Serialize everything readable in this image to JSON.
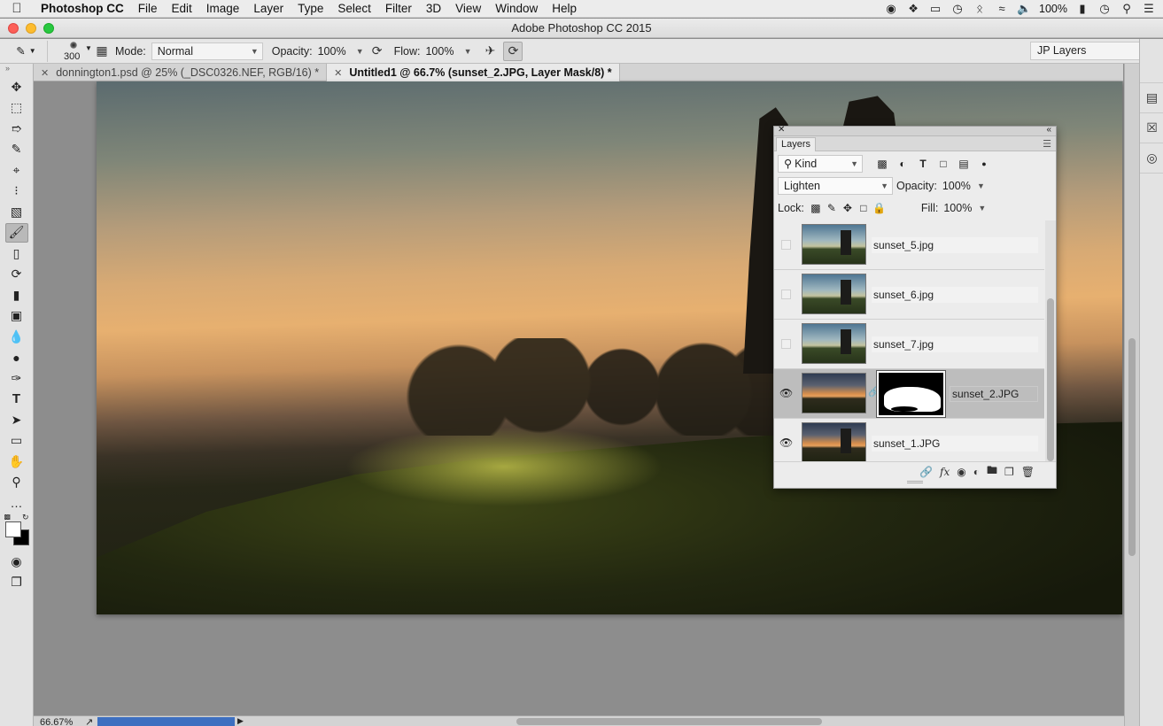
{
  "menubar": {
    "app": "Photoshop CC",
    "items": [
      "File",
      "Edit",
      "Image",
      "Layer",
      "Type",
      "Select",
      "Filter",
      "3D",
      "View",
      "Window",
      "Help"
    ],
    "battery": "100%"
  },
  "window": {
    "title": "Adobe Photoshop CC 2015"
  },
  "options": {
    "brush_size": "300",
    "mode_label": "Mode:",
    "mode_value": "Normal",
    "opacity_label": "Opacity:",
    "opacity_value": "100%",
    "flow_label": "Flow:",
    "flow_value": "100%",
    "workspace": "JP Layers"
  },
  "tabs": [
    {
      "label": "donnington1.psd @ 25% (_DSC0326.NEF, RGB/16) *",
      "active": false
    },
    {
      "label": "Untitled1 @ 66.7% (sunset_2.JPG, Layer Mask/8) *",
      "active": true
    }
  ],
  "status": {
    "zoom": "66.67%"
  },
  "layers_panel": {
    "tab": "Layers",
    "filter_kind": "Kind",
    "blend_mode": "Lighten",
    "opacity_label": "Opacity:",
    "opacity_value": "100%",
    "lock_label": "Lock:",
    "fill_label": "Fill:",
    "fill_value": "100%",
    "layers": [
      {
        "name": "sunset_5.jpg",
        "visible": false,
        "has_mask": false,
        "selected": false
      },
      {
        "name": "sunset_6.jpg",
        "visible": false,
        "has_mask": false,
        "selected": false
      },
      {
        "name": "sunset_7.jpg",
        "visible": false,
        "has_mask": false,
        "selected": false
      },
      {
        "name": "sunset_2.JPG",
        "visible": true,
        "has_mask": true,
        "selected": true
      },
      {
        "name": "sunset_1.JPG",
        "visible": true,
        "has_mask": false,
        "selected": false
      }
    ]
  }
}
